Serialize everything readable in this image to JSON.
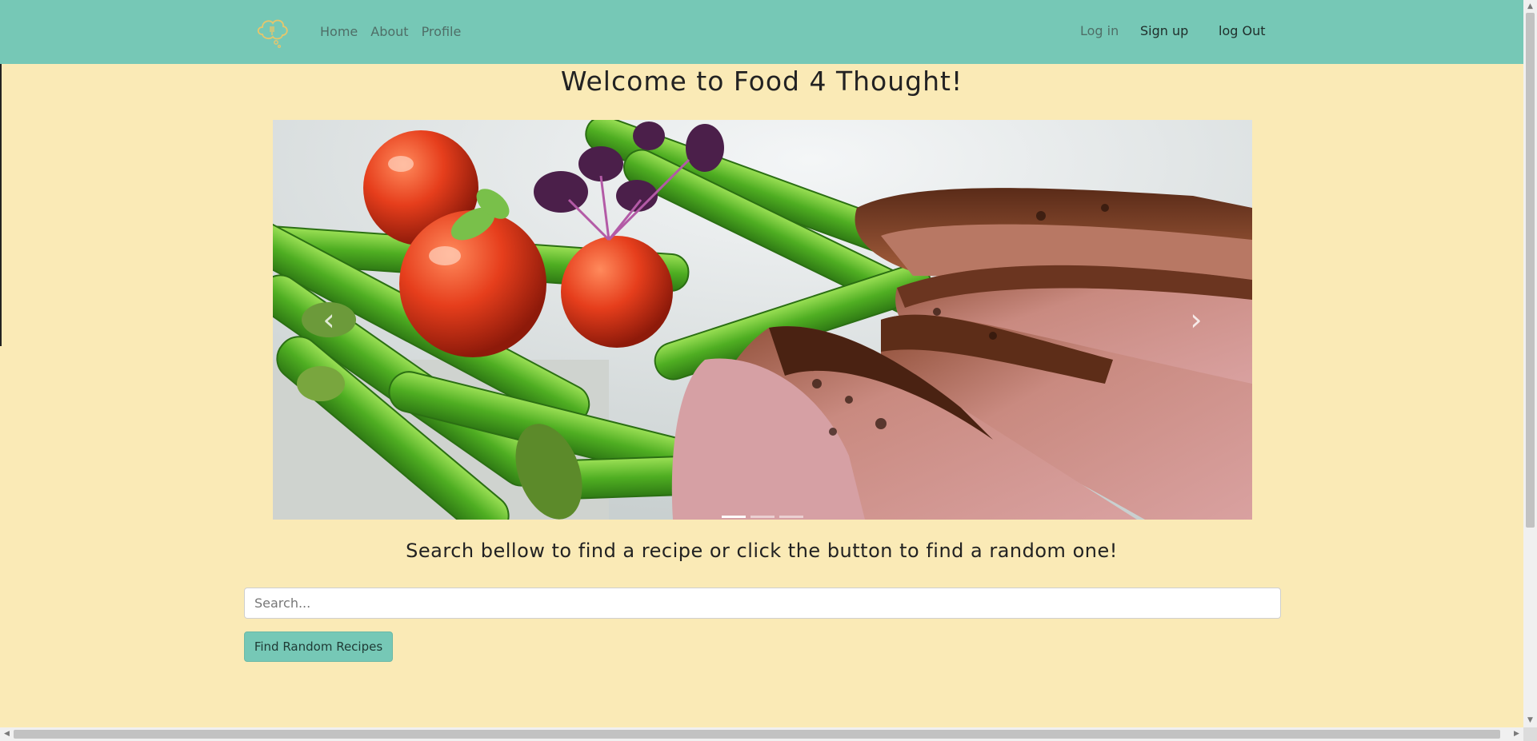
{
  "nav": {
    "links": [
      "Home",
      "About",
      "Profile"
    ],
    "login": "Log in",
    "signup": "Sign up",
    "logout": "log Out"
  },
  "page_title": "Welcome to Food 4 Thought!",
  "carousel": {
    "prev_label": "‹",
    "next_label": "›",
    "active_index": 0,
    "slide_count": 3
  },
  "subtitle": "Search bellow to find a recipe or click the button to find a random one!",
  "search": {
    "placeholder": "Search...",
    "value": ""
  },
  "random_button_label": "Find Random Recipes",
  "colors": {
    "navbar": "#76c8b6",
    "background": "#faeab6",
    "button": "#76c8b6"
  }
}
